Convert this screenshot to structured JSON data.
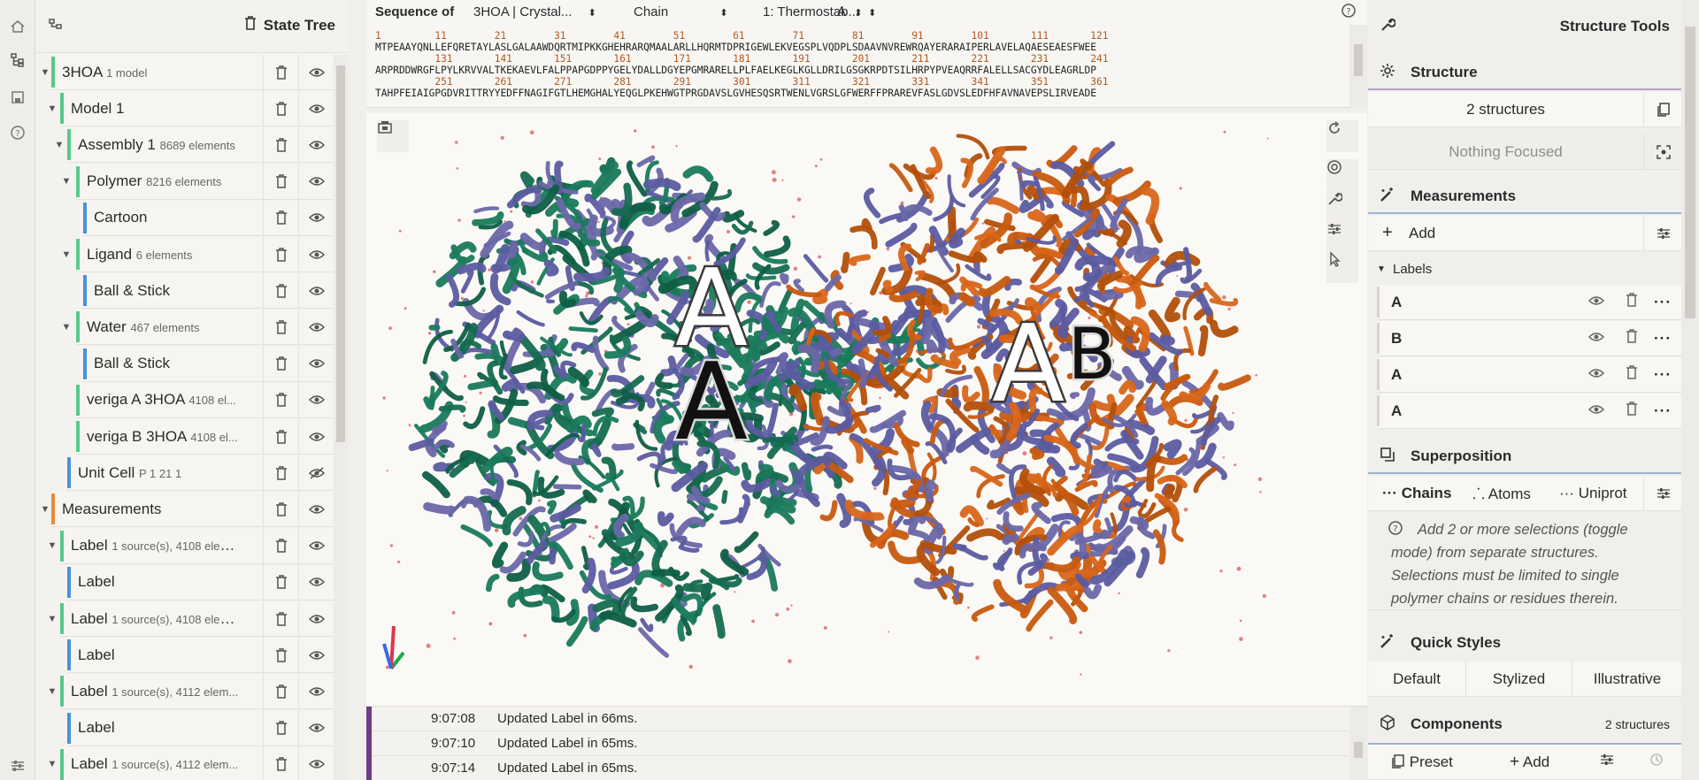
{
  "tree": {
    "title": "State Tree",
    "rows": [
      {
        "label": "3HOA",
        "meta": "1 model",
        "has_caret": true
      },
      {
        "label": "Model 1",
        "meta": "",
        "has_caret": true
      },
      {
        "label": "Assembly 1",
        "meta": "8689 elements",
        "has_caret": true
      },
      {
        "label": "Polymer",
        "meta": "8216 elements",
        "has_caret": true
      },
      {
        "label": "Cartoon",
        "meta": "",
        "has_caret": false
      },
      {
        "label": "Ligand",
        "meta": "6 elements",
        "has_caret": true
      },
      {
        "label": "Ball & Stick",
        "meta": "",
        "has_caret": false
      },
      {
        "label": "Water",
        "meta": "467 elements",
        "has_caret": true
      },
      {
        "label": "Ball & Stick",
        "meta": "",
        "has_caret": false
      },
      {
        "label": "veriga A 3HOA",
        "meta": "4108 el...",
        "has_caret": false
      },
      {
        "label": "veriga B 3HOA",
        "meta": "4108 el...",
        "has_caret": false
      },
      {
        "label": "Unit Cell",
        "meta": "P 1 21 1",
        "has_caret": false
      },
      {
        "label": "Measurements",
        "meta": "",
        "has_caret": true
      },
      {
        "label": "Label",
        "meta": "1 source(s), 4108 elem...",
        "has_caret": true
      },
      {
        "label": "Label",
        "meta": "",
        "has_caret": false
      },
      {
        "label": "Label",
        "meta": "1 source(s), 4108 elem...",
        "has_caret": true
      },
      {
        "label": "Label",
        "meta": "",
        "has_caret": false
      },
      {
        "label": "Label",
        "meta": "1 source(s), 4112 elem...",
        "has_caret": true
      },
      {
        "label": "Label",
        "meta": "",
        "has_caret": false
      },
      {
        "label": "Label",
        "meta": "1 source(s), 4112 elem...",
        "has_caret": true
      }
    ]
  },
  "sequence": {
    "prefix": "Sequence of",
    "entry": "3HOA | Crystal...",
    "mode": "Chain",
    "entity": "1: Thermostab...",
    "chain": "A",
    "lines": [
      {
        "nums": "1         11        21        31        41        51        61        71        81        91        101       111       121",
        "seq": "MTPEAAYQNLLEFQRETAYLASLGALAAWDQRTMIPKKGHEHRARQMAALARLLHQRMTDPRIGEWLEKVEGSPLVQDPLSDAAVNVREWRQAYERARAIPERLAVELAQAESEAESFWEE"
      },
      {
        "nums": "          131       141       151       161       171       181       191       201       211       221       231       241",
        "seq": "ARPRDDWRGFLPYLKRVVALTKEKAEVLFALPPAPGDPPYGELYDALLDGYEPGMRARELLPLFAELKEGLKGLLDRILGSGKRPDTSILHRPYPVEAQRRFALELLSACGYDLEAGRLDP"
      },
      {
        "nums": "          251       261       271       281       291       301       311       321       331       341       351       361",
        "seq": "TAHPFEIAIGPGDVRITTRYYEDFFNAGIFGTLHEMGHALYEQGLPKEHWGTPRGDAVSLGVHESQSRTWENLVGRSLGFWERFFPRAREVFASLGDVSLEDFHFAVNAVEPSLIRVEADE"
      }
    ]
  },
  "viewport": {
    "labels": [
      "A",
      "A",
      "A",
      "B"
    ]
  },
  "log": [
    {
      "time": "9:07:08",
      "message": "Updated Label in 66ms."
    },
    {
      "time": "9:07:10",
      "message": "Updated Label in 65ms."
    },
    {
      "time": "9:07:14",
      "message": "Updated Label in 65ms."
    }
  ],
  "right": {
    "title": "Structure Tools",
    "structure": {
      "title": "Structure",
      "count": "2 structures",
      "focus": "Nothing Focused"
    },
    "measurements": {
      "title": "Measurements",
      "add": "Add",
      "labels_title": "Labels",
      "labels": [
        "A",
        "B",
        "A",
        "A"
      ]
    },
    "superposition": {
      "title": "Superposition",
      "tabs": [
        "Chains",
        "Atoms",
        "Uniprot"
      ],
      "help": "Add 2 or more selections (toggle mode) from separate structures. Selections must be limited to single polymer chains or residues therein."
    },
    "quick_styles": {
      "title": "Quick Styles",
      "options": [
        "Default",
        "Stylized",
        "Illustrative"
      ]
    },
    "components": {
      "title": "Components",
      "count": "2 structures",
      "preset": "Preset",
      "add": "Add"
    }
  }
}
